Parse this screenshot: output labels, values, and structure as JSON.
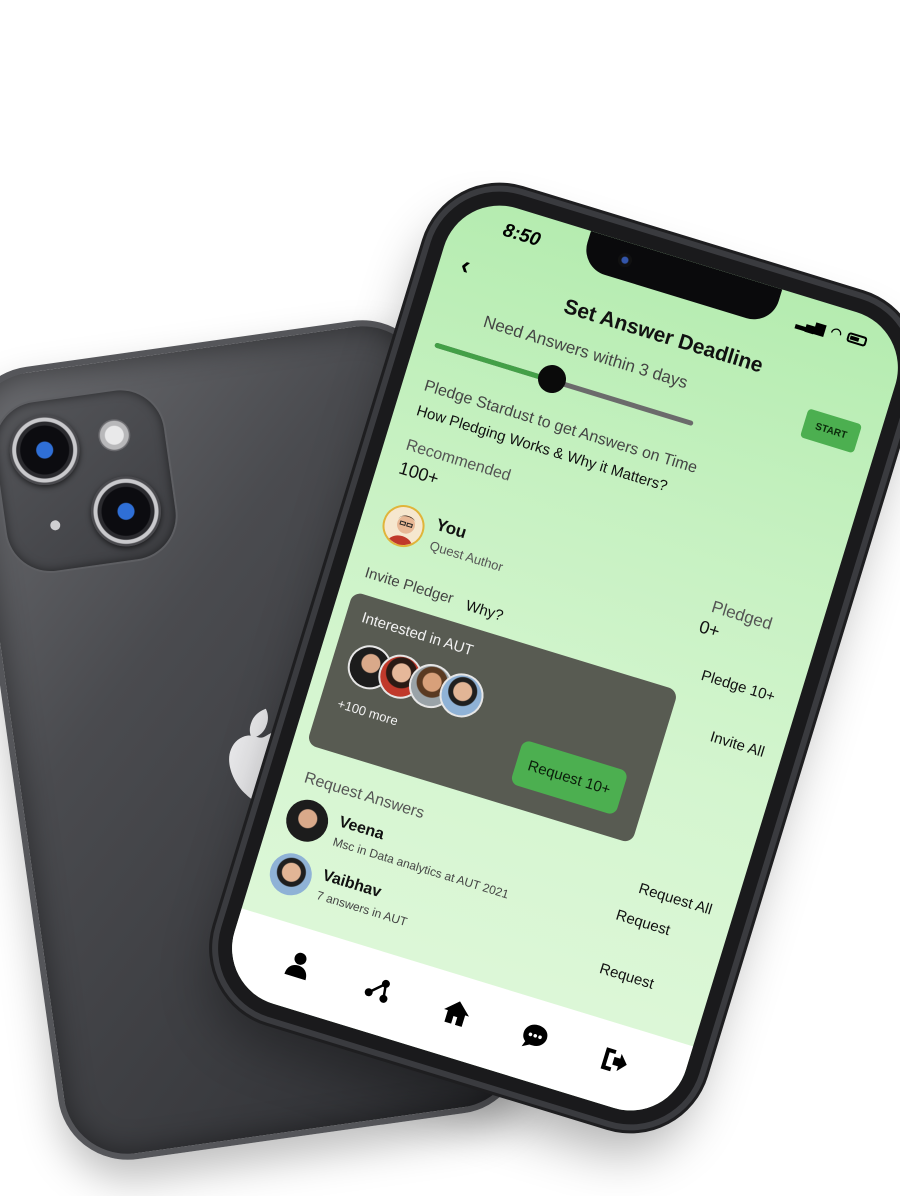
{
  "status_bar": {
    "time": "8:50",
    "signal_icon": "signal-icon",
    "wifi_icon": "wifi-icon",
    "battery_icon": "battery-icon"
  },
  "header": {
    "back_icon": "chevron-left-icon",
    "title": "Set Answer Deadline"
  },
  "deadline": {
    "label": "Need Answers within 3 days",
    "start_label": "START",
    "slider_fraction": 0.45
  },
  "pledge": {
    "label": "Pledge Stardust to get Answers on Time",
    "how_link": "How Pledging Works & Why it Matters?"
  },
  "recommended": {
    "label": "Recommended",
    "value": "100+"
  },
  "author": {
    "name": "You",
    "role": "Quest Author",
    "pledged_label": "Pledged",
    "pledged_value": "0+"
  },
  "invite": {
    "label": "Invite Pledger",
    "why_link": "Why?",
    "pledge_action": "Pledge 10+",
    "invite_all": "Invite All"
  },
  "interest_card": {
    "title": "Interested in AUT",
    "more": "+100 more",
    "request_button": "Request 10+"
  },
  "request_section": {
    "label": "Request Answers",
    "request_all": "Request All"
  },
  "people": [
    {
      "name": "Veena",
      "detail": "Msc in Data analytics at AUT 2021",
      "action": "Request"
    },
    {
      "name": "Vaibhav",
      "detail": "7 answers in AUT",
      "action": "Request"
    }
  ],
  "bottom_nav": [
    "person-icon",
    "network-icon",
    "home-icon",
    "chat-icon",
    "logout-icon"
  ],
  "colors": {
    "accent": "#4caf50",
    "card": "#585b52",
    "screen_bg": "#c6f1c1"
  }
}
